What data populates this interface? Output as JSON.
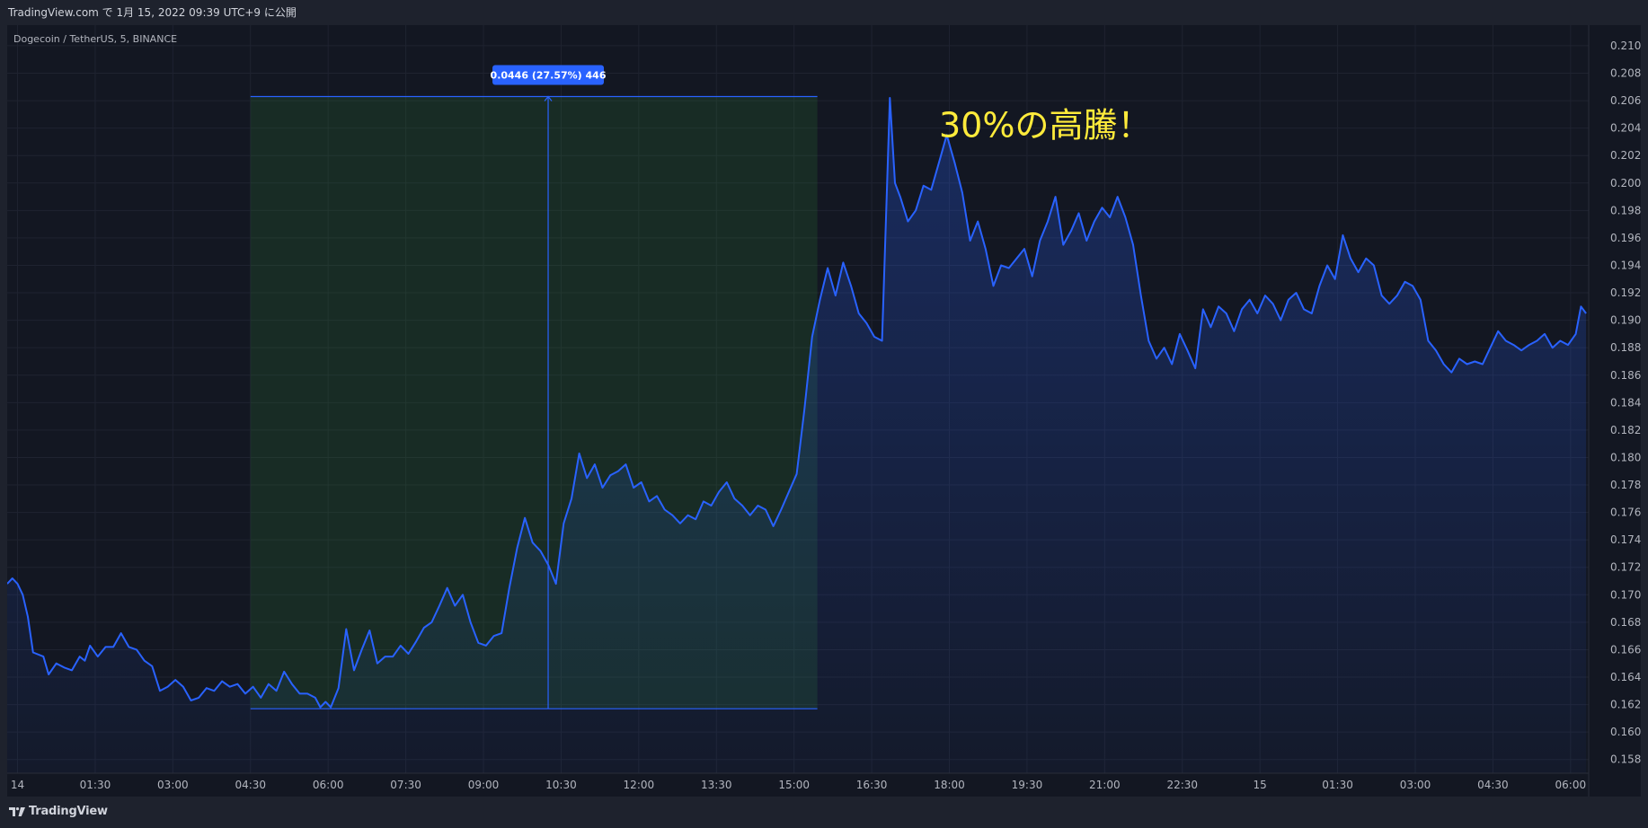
{
  "header": {
    "published": "TradingView.com で 1月 15, 2022 09:39 UTC+9 に公開"
  },
  "footer": {
    "brand": "TradingView"
  },
  "colors": {
    "line": "#2962ff",
    "area_top": "#2962ff",
    "range_fill": "#2e7d32",
    "annotation": "#ffeb3b",
    "label_bg": "#2962ff",
    "background": "#131722"
  },
  "chart_data": {
    "type": "area",
    "title": "Dogecoin / TetherUS, 5, BINANCE",
    "xlabel": "",
    "ylabel": "",
    "ylim": [
      0.157,
      0.2115
    ],
    "y_ticks": [
      0.158,
      0.16,
      0.162,
      0.164,
      0.166,
      0.168,
      0.17,
      0.172,
      0.174,
      0.176,
      0.178,
      0.18,
      0.182,
      0.184,
      0.186,
      0.188,
      0.19,
      0.192,
      0.194,
      0.196,
      0.198,
      0.2,
      0.202,
      0.204,
      0.206,
      0.208,
      0.21
    ],
    "x_start": "2022-01-14 00:00",
    "x_ticks": [
      {
        "label": "14",
        "h": 0
      },
      {
        "label": "01:30",
        "h": 1.5
      },
      {
        "label": "03:00",
        "h": 3
      },
      {
        "label": "04:30",
        "h": 4.5
      },
      {
        "label": "06:00",
        "h": 6
      },
      {
        "label": "07:30",
        "h": 7.5
      },
      {
        "label": "09:00",
        "h": 9
      },
      {
        "label": "10:30",
        "h": 10.5
      },
      {
        "label": "12:00",
        "h": 12
      },
      {
        "label": "13:30",
        "h": 13.5
      },
      {
        "label": "15:00",
        "h": 15
      },
      {
        "label": "16:30",
        "h": 16.5
      },
      {
        "label": "18:00",
        "h": 18
      },
      {
        "label": "19:30",
        "h": 19.5
      },
      {
        "label": "21:00",
        "h": 21
      },
      {
        "label": "22:30",
        "h": 22.5
      },
      {
        "label": "15",
        "h": 24
      },
      {
        "label": "01:30",
        "h": 25.5
      },
      {
        "label": "03:00",
        "h": 27
      },
      {
        "label": "04:30",
        "h": 28.5
      },
      {
        "label": "06:00",
        "h": 30
      }
    ],
    "x_start_hours": -0.2,
    "x_end_hours": 30.35,
    "series": [
      {
        "points": [
          [
            -0.2,
            0.1708
          ],
          [
            -0.1,
            0.1712
          ],
          [
            0.0,
            0.1708
          ],
          [
            0.1,
            0.17
          ],
          [
            0.2,
            0.1684
          ],
          [
            0.3,
            0.1658
          ],
          [
            0.5,
            0.1655
          ],
          [
            0.6,
            0.1642
          ],
          [
            0.75,
            0.165
          ],
          [
            0.9,
            0.1647
          ],
          [
            1.05,
            0.1645
          ],
          [
            1.2,
            0.1655
          ],
          [
            1.3,
            0.1652
          ],
          [
            1.4,
            0.1663
          ],
          [
            1.55,
            0.1655
          ],
          [
            1.7,
            0.1662
          ],
          [
            1.85,
            0.1662
          ],
          [
            2.0,
            0.1672
          ],
          [
            2.15,
            0.1662
          ],
          [
            2.3,
            0.166
          ],
          [
            2.45,
            0.1652
          ],
          [
            2.6,
            0.1648
          ],
          [
            2.75,
            0.163
          ],
          [
            2.9,
            0.1633
          ],
          [
            3.05,
            0.1638
          ],
          [
            3.2,
            0.1633
          ],
          [
            3.35,
            0.1623
          ],
          [
            3.5,
            0.1625
          ],
          [
            3.65,
            0.1632
          ],
          [
            3.8,
            0.163
          ],
          [
            3.95,
            0.1637
          ],
          [
            4.1,
            0.1633
          ],
          [
            4.25,
            0.1635
          ],
          [
            4.4,
            0.1628
          ],
          [
            4.55,
            0.1633
          ],
          [
            4.7,
            0.1625
          ],
          [
            4.85,
            0.1635
          ],
          [
            5.0,
            0.163
          ],
          [
            5.15,
            0.1644
          ],
          [
            5.3,
            0.1635
          ],
          [
            5.45,
            0.1628
          ],
          [
            5.6,
            0.1628
          ],
          [
            5.75,
            0.1625
          ],
          [
            5.85,
            0.1618
          ],
          [
            5.95,
            0.1622
          ],
          [
            6.05,
            0.1618
          ],
          [
            6.2,
            0.1632
          ],
          [
            6.35,
            0.1675
          ],
          [
            6.5,
            0.1645
          ],
          [
            6.65,
            0.166
          ],
          [
            6.8,
            0.1674
          ],
          [
            6.95,
            0.165
          ],
          [
            7.1,
            0.1655
          ],
          [
            7.25,
            0.1655
          ],
          [
            7.4,
            0.1663
          ],
          [
            7.55,
            0.1657
          ],
          [
            7.7,
            0.1666
          ],
          [
            7.85,
            0.1676
          ],
          [
            8.0,
            0.168
          ],
          [
            8.15,
            0.1692
          ],
          [
            8.3,
            0.1705
          ],
          [
            8.45,
            0.1692
          ],
          [
            8.6,
            0.17
          ],
          [
            8.75,
            0.168
          ],
          [
            8.9,
            0.1665
          ],
          [
            9.05,
            0.1663
          ],
          [
            9.2,
            0.167
          ],
          [
            9.35,
            0.1672
          ],
          [
            9.5,
            0.1705
          ],
          [
            9.65,
            0.1734
          ],
          [
            9.8,
            0.1756
          ],
          [
            9.95,
            0.1738
          ],
          [
            10.1,
            0.1732
          ],
          [
            10.25,
            0.1722
          ],
          [
            10.4,
            0.1708
          ],
          [
            10.55,
            0.1752
          ],
          [
            10.7,
            0.177
          ],
          [
            10.85,
            0.1803
          ],
          [
            11.0,
            0.1785
          ],
          [
            11.15,
            0.1795
          ],
          [
            11.3,
            0.1778
          ],
          [
            11.45,
            0.1787
          ],
          [
            11.6,
            0.179
          ],
          [
            11.75,
            0.1795
          ],
          [
            11.9,
            0.1778
          ],
          [
            12.05,
            0.1782
          ],
          [
            12.2,
            0.1768
          ],
          [
            12.35,
            0.1772
          ],
          [
            12.5,
            0.1762
          ],
          [
            12.65,
            0.1758
          ],
          [
            12.8,
            0.1752
          ],
          [
            12.95,
            0.1758
          ],
          [
            13.1,
            0.1755
          ],
          [
            13.25,
            0.1768
          ],
          [
            13.4,
            0.1765
          ],
          [
            13.55,
            0.1775
          ],
          [
            13.7,
            0.1782
          ],
          [
            13.85,
            0.177
          ],
          [
            14.0,
            0.1765
          ],
          [
            14.15,
            0.1758
          ],
          [
            14.3,
            0.1765
          ],
          [
            14.45,
            0.1762
          ],
          [
            14.6,
            0.175
          ],
          [
            14.75,
            0.1762
          ],
          [
            14.9,
            0.1775
          ],
          [
            15.05,
            0.1788
          ],
          [
            15.2,
            0.1835
          ],
          [
            15.35,
            0.1888
          ],
          [
            15.5,
            0.1915
          ],
          [
            15.65,
            0.1938
          ],
          [
            15.8,
            0.1918
          ],
          [
            15.95,
            0.1942
          ],
          [
            16.1,
            0.1925
          ],
          [
            16.25,
            0.1905
          ],
          [
            16.4,
            0.1898
          ],
          [
            16.55,
            0.1888
          ],
          [
            16.7,
            0.1885
          ],
          [
            16.85,
            0.2062
          ],
          [
            16.95,
            0.2
          ],
          [
            17.05,
            0.199
          ],
          [
            17.2,
            0.1972
          ],
          [
            17.35,
            0.198
          ],
          [
            17.5,
            0.1998
          ],
          [
            17.65,
            0.1995
          ],
          [
            17.8,
            0.2015
          ],
          [
            17.95,
            0.2035
          ],
          [
            18.1,
            0.2015
          ],
          [
            18.25,
            0.1993
          ],
          [
            18.4,
            0.1958
          ],
          [
            18.55,
            0.1972
          ],
          [
            18.7,
            0.1952
          ],
          [
            18.85,
            0.1925
          ],
          [
            19.0,
            0.194
          ],
          [
            19.15,
            0.1938
          ],
          [
            19.3,
            0.1945
          ],
          [
            19.45,
            0.1952
          ],
          [
            19.6,
            0.1932
          ],
          [
            19.75,
            0.1958
          ],
          [
            19.9,
            0.1972
          ],
          [
            20.05,
            0.199
          ],
          [
            20.2,
            0.1955
          ],
          [
            20.35,
            0.1965
          ],
          [
            20.5,
            0.1978
          ],
          [
            20.65,
            0.1958
          ],
          [
            20.8,
            0.1972
          ],
          [
            20.95,
            0.1982
          ],
          [
            21.1,
            0.1975
          ],
          [
            21.25,
            0.199
          ],
          [
            21.4,
            0.1975
          ],
          [
            21.55,
            0.1955
          ],
          [
            21.7,
            0.1918
          ],
          [
            21.85,
            0.1885
          ],
          [
            22.0,
            0.1872
          ],
          [
            22.15,
            0.188
          ],
          [
            22.3,
            0.1868
          ],
          [
            22.45,
            0.189
          ],
          [
            22.6,
            0.1878
          ],
          [
            22.75,
            0.1865
          ],
          [
            22.9,
            0.1908
          ],
          [
            23.05,
            0.1895
          ],
          [
            23.2,
            0.191
          ],
          [
            23.35,
            0.1905
          ],
          [
            23.5,
            0.1892
          ],
          [
            23.65,
            0.1908
          ],
          [
            23.8,
            0.1915
          ],
          [
            23.95,
            0.1905
          ],
          [
            24.1,
            0.1918
          ],
          [
            24.25,
            0.1912
          ],
          [
            24.4,
            0.19
          ],
          [
            24.55,
            0.1915
          ],
          [
            24.7,
            0.192
          ],
          [
            24.85,
            0.1908
          ],
          [
            25.0,
            0.1905
          ],
          [
            25.15,
            0.1925
          ],
          [
            25.3,
            0.194
          ],
          [
            25.45,
            0.193
          ],
          [
            25.6,
            0.1962
          ],
          [
            25.75,
            0.1945
          ],
          [
            25.9,
            0.1935
          ],
          [
            26.05,
            0.1945
          ],
          [
            26.2,
            0.194
          ],
          [
            26.35,
            0.1918
          ],
          [
            26.5,
            0.1912
          ],
          [
            26.65,
            0.1918
          ],
          [
            26.8,
            0.1928
          ],
          [
            26.95,
            0.1925
          ],
          [
            27.1,
            0.1915
          ],
          [
            27.25,
            0.1885
          ],
          [
            27.4,
            0.1878
          ],
          [
            27.55,
            0.1868
          ],
          [
            27.7,
            0.1862
          ],
          [
            27.85,
            0.1872
          ],
          [
            28.0,
            0.1868
          ],
          [
            28.15,
            0.187
          ],
          [
            28.3,
            0.1868
          ],
          [
            28.45,
            0.188
          ],
          [
            28.6,
            0.1892
          ],
          [
            28.75,
            0.1885
          ],
          [
            28.9,
            0.1882
          ],
          [
            29.05,
            0.1878
          ],
          [
            29.2,
            0.1882
          ],
          [
            29.35,
            0.1885
          ],
          [
            29.5,
            0.189
          ],
          [
            29.65,
            0.188
          ],
          [
            29.8,
            0.1885
          ],
          [
            29.95,
            0.1882
          ],
          [
            30.1,
            0.189
          ],
          [
            30.2,
            0.191
          ],
          [
            30.3,
            0.1905
          ]
        ]
      }
    ],
    "measure_range": {
      "start_hours": 4.5,
      "end_hours": 15.45,
      "low": 0.1617,
      "high": 0.2063,
      "label": "0.0446 (27.57%) 446",
      "mid_hours": 10.25
    },
    "annotations": [
      {
        "text": "30%の高騰！",
        "x_hours": 17.8,
        "y_value": 0.2042
      }
    ]
  }
}
